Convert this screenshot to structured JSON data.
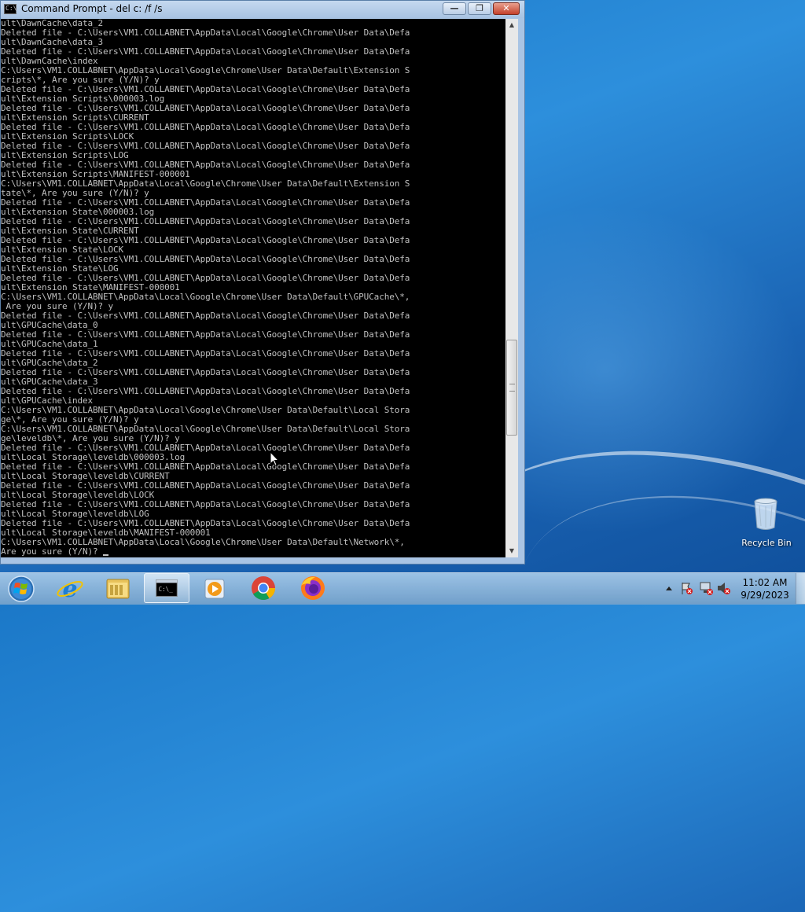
{
  "window": {
    "title": "Command Prompt - del  c: /f /s",
    "minimize_glyph": "—",
    "maximize_glyph": "❐",
    "close_glyph": "✕"
  },
  "console": {
    "lines": [
      "ult\\DawnCache\\data_2",
      "Deleted file - C:\\Users\\VM1.COLLABNET\\AppData\\Local\\Google\\Chrome\\User Data\\Defa",
      "ult\\DawnCache\\data_3",
      "Deleted file - C:\\Users\\VM1.COLLABNET\\AppData\\Local\\Google\\Chrome\\User Data\\Defa",
      "ult\\DawnCache\\index",
      "C:\\Users\\VM1.COLLABNET\\AppData\\Local\\Google\\Chrome\\User Data\\Default\\Extension S",
      "cripts\\*, Are you sure (Y/N)? y",
      "Deleted file - C:\\Users\\VM1.COLLABNET\\AppData\\Local\\Google\\Chrome\\User Data\\Defa",
      "ult\\Extension Scripts\\000003.log",
      "Deleted file - C:\\Users\\VM1.COLLABNET\\AppData\\Local\\Google\\Chrome\\User Data\\Defa",
      "ult\\Extension Scripts\\CURRENT",
      "Deleted file - C:\\Users\\VM1.COLLABNET\\AppData\\Local\\Google\\Chrome\\User Data\\Defa",
      "ult\\Extension Scripts\\LOCK",
      "Deleted file - C:\\Users\\VM1.COLLABNET\\AppData\\Local\\Google\\Chrome\\User Data\\Defa",
      "ult\\Extension Scripts\\LOG",
      "Deleted file - C:\\Users\\VM1.COLLABNET\\AppData\\Local\\Google\\Chrome\\User Data\\Defa",
      "ult\\Extension Scripts\\MANIFEST-000001",
      "C:\\Users\\VM1.COLLABNET\\AppData\\Local\\Google\\Chrome\\User Data\\Default\\Extension S",
      "tate\\*, Are you sure (Y/N)? y",
      "Deleted file - C:\\Users\\VM1.COLLABNET\\AppData\\Local\\Google\\Chrome\\User Data\\Defa",
      "ult\\Extension State\\000003.log",
      "Deleted file - C:\\Users\\VM1.COLLABNET\\AppData\\Local\\Google\\Chrome\\User Data\\Defa",
      "ult\\Extension State\\CURRENT",
      "Deleted file - C:\\Users\\VM1.COLLABNET\\AppData\\Local\\Google\\Chrome\\User Data\\Defa",
      "ult\\Extension State\\LOCK",
      "Deleted file - C:\\Users\\VM1.COLLABNET\\AppData\\Local\\Google\\Chrome\\User Data\\Defa",
      "ult\\Extension State\\LOG",
      "Deleted file - C:\\Users\\VM1.COLLABNET\\AppData\\Local\\Google\\Chrome\\User Data\\Defa",
      "ult\\Extension State\\MANIFEST-000001",
      "C:\\Users\\VM1.COLLABNET\\AppData\\Local\\Google\\Chrome\\User Data\\Default\\GPUCache\\*,",
      " Are you sure (Y/N)? y",
      "Deleted file - C:\\Users\\VM1.COLLABNET\\AppData\\Local\\Google\\Chrome\\User Data\\Defa",
      "ult\\GPUCache\\data_0",
      "Deleted file - C:\\Users\\VM1.COLLABNET\\AppData\\Local\\Google\\Chrome\\User Data\\Defa",
      "ult\\GPUCache\\data_1",
      "Deleted file - C:\\Users\\VM1.COLLABNET\\AppData\\Local\\Google\\Chrome\\User Data\\Defa",
      "ult\\GPUCache\\data_2",
      "Deleted file - C:\\Users\\VM1.COLLABNET\\AppData\\Local\\Google\\Chrome\\User Data\\Defa",
      "ult\\GPUCache\\data_3",
      "Deleted file - C:\\Users\\VM1.COLLABNET\\AppData\\Local\\Google\\Chrome\\User Data\\Defa",
      "ult\\GPUCache\\index",
      "C:\\Users\\VM1.COLLABNET\\AppData\\Local\\Google\\Chrome\\User Data\\Default\\Local Stora",
      "ge\\*, Are you sure (Y/N)? y",
      "C:\\Users\\VM1.COLLABNET\\AppData\\Local\\Google\\Chrome\\User Data\\Default\\Local Stora",
      "ge\\leveldb\\*, Are you sure (Y/N)? y",
      "Deleted file - C:\\Users\\VM1.COLLABNET\\AppData\\Local\\Google\\Chrome\\User Data\\Defa",
      "ult\\Local Storage\\leveldb\\000003.log",
      "Deleted file - C:\\Users\\VM1.COLLABNET\\AppData\\Local\\Google\\Chrome\\User Data\\Defa",
      "ult\\Local Storage\\leveldb\\CURRENT",
      "Deleted file - C:\\Users\\VM1.COLLABNET\\AppData\\Local\\Google\\Chrome\\User Data\\Defa",
      "ult\\Local Storage\\leveldb\\LOCK",
      "Deleted file - C:\\Users\\VM1.COLLABNET\\AppData\\Local\\Google\\Chrome\\User Data\\Defa",
      "ult\\Local Storage\\leveldb\\LOG",
      "Deleted file - C:\\Users\\VM1.COLLABNET\\AppData\\Local\\Google\\Chrome\\User Data\\Defa",
      "ult\\Local Storage\\leveldb\\MANIFEST-000001",
      "C:\\Users\\VM1.COLLABNET\\AppData\\Local\\Google\\Chrome\\User Data\\Default\\Network\\*,",
      "Are you sure (Y/N)? "
    ]
  },
  "desktop": {
    "recycle_bin_label": "Recycle Bin"
  },
  "taskbar": {
    "items": [
      {
        "icon": "internet-explorer-icon"
      },
      {
        "icon": "file-explorer-icon"
      },
      {
        "icon": "command-prompt-icon",
        "active": true
      },
      {
        "icon": "media-player-icon"
      },
      {
        "icon": "chrome-icon"
      },
      {
        "icon": "firefox-icon"
      }
    ],
    "clock_time": "11:02 AM",
    "clock_date": "9/29/2023"
  },
  "colors": {
    "console_bg": "#000000",
    "console_text": "#c0c0c0",
    "desktop_blue": "#1b78c8"
  }
}
